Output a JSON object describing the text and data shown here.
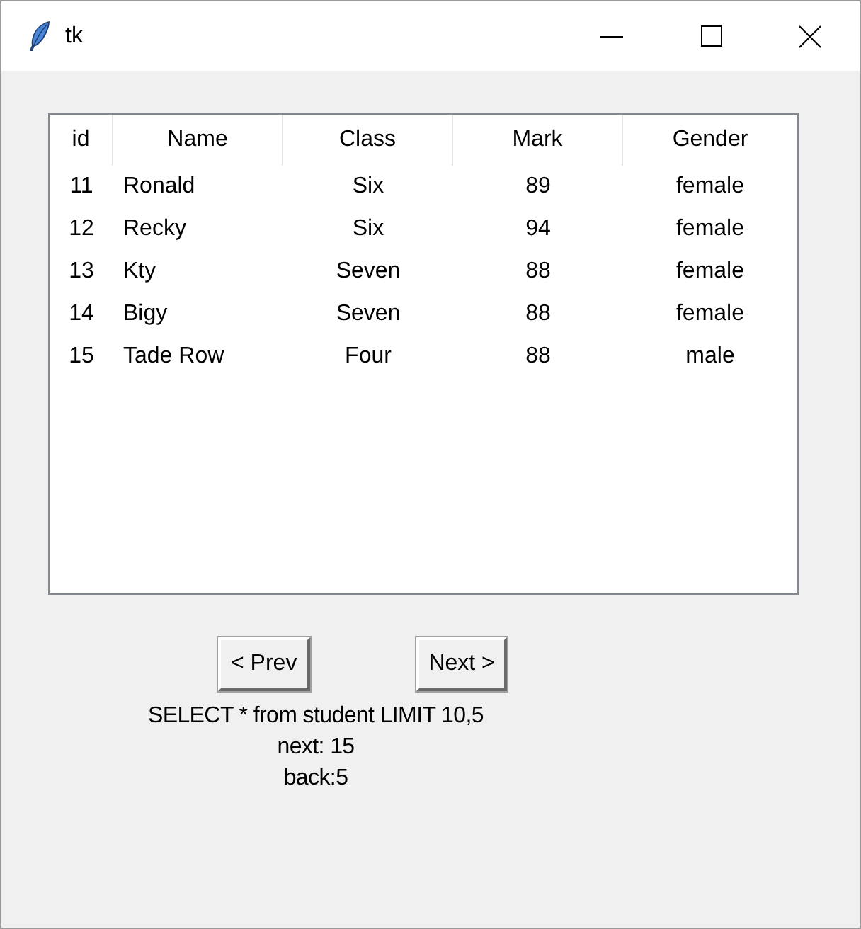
{
  "window": {
    "title": "tk"
  },
  "table": {
    "columns": [
      "id",
      "Name",
      "Class",
      "Mark",
      "Gender"
    ],
    "rows": [
      [
        "11",
        "Ronald",
        "Six",
        "89",
        "female"
      ],
      [
        "12",
        "Recky",
        "Six",
        "94",
        "female"
      ],
      [
        "13",
        "Kty",
        "Seven",
        "88",
        "female"
      ],
      [
        "14",
        "Bigy",
        "Seven",
        "88",
        "female"
      ],
      [
        "15",
        "Tade Row",
        "Four",
        "88",
        "male"
      ]
    ]
  },
  "buttons": [
    {
      "label": "< Prev"
    },
    {
      "label": "Next >"
    }
  ],
  "info_label": {
    "lines": [
      "SELECT * from student LIMIT 10,5",
      "next: 15",
      "back:5"
    ]
  }
}
